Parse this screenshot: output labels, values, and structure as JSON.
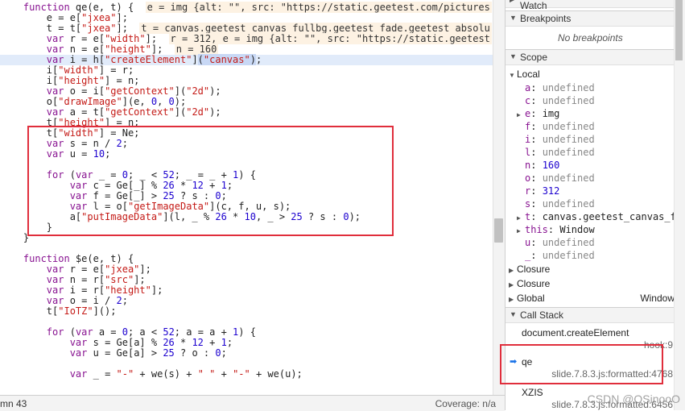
{
  "code_lines": [
    {
      "parts": [
        {
          "t": "    "
        },
        {
          "c": "kw",
          "t": "function"
        },
        {
          "t": " qe(e, t) {  "
        },
        {
          "c": "inline-val",
          "t": "e = img {alt: \"\", src: \"https://static.geetest.com/pictures"
        }
      ]
    },
    {
      "parts": [
        {
          "t": "        e = e["
        },
        {
          "c": "str",
          "t": "\"jxea\""
        },
        {
          "t": "];"
        }
      ]
    },
    {
      "parts": [
        {
          "t": "        t = t["
        },
        {
          "c": "str",
          "t": "\"jxea\""
        },
        {
          "t": "];  "
        },
        {
          "c": "inline-val",
          "t": "t = canvas.geetest_canvas_fullbg.geetest_fade.geetest_absolu"
        }
      ]
    },
    {
      "parts": [
        {
          "t": "        "
        },
        {
          "c": "kw",
          "t": "var"
        },
        {
          "t": " r = e["
        },
        {
          "c": "str",
          "t": "\"width\""
        },
        {
          "t": "];  "
        },
        {
          "c": "inline-val",
          "t": "r = 312, e = img {alt: \"\", src: \"https://static.geetest"
        }
      ]
    },
    {
      "parts": [
        {
          "t": "        "
        },
        {
          "c": "kw",
          "t": "var"
        },
        {
          "t": " n = e["
        },
        {
          "c": "str",
          "t": "\"height\""
        },
        {
          "t": "];  "
        },
        {
          "c": "inline-val",
          "t": "n = 160"
        }
      ]
    },
    {
      "exec": true,
      "parts": [
        {
          "t": "        "
        },
        {
          "c": "kw",
          "t": "var"
        },
        {
          "t": " i = h["
        },
        {
          "c": "str",
          "t": "\"createElement\""
        },
        {
          "t": "]"
        },
        {
          "c": "sel",
          "t": "("
        },
        {
          "c": "str sel",
          "t": "\"canvas\""
        },
        {
          "c": "sel",
          "t": ")"
        },
        {
          "t": ";"
        }
      ]
    },
    {
      "parts": [
        {
          "t": "        i["
        },
        {
          "c": "str",
          "t": "\"width\""
        },
        {
          "t": "] = r;"
        }
      ]
    },
    {
      "parts": [
        {
          "t": "        i["
        },
        {
          "c": "str",
          "t": "\"height\""
        },
        {
          "t": "] = n;"
        }
      ]
    },
    {
      "parts": [
        {
          "t": "        "
        },
        {
          "c": "kw",
          "t": "var"
        },
        {
          "t": " o = i["
        },
        {
          "c": "str",
          "t": "\"getContext\""
        },
        {
          "t": "]("
        },
        {
          "c": "str",
          "t": "\"2d\""
        },
        {
          "t": ");"
        }
      ]
    },
    {
      "parts": [
        {
          "t": "        o["
        },
        {
          "c": "str",
          "t": "\"drawImage\""
        },
        {
          "t": "](e, "
        },
        {
          "c": "num",
          "t": "0"
        },
        {
          "t": ", "
        },
        {
          "c": "num",
          "t": "0"
        },
        {
          "t": ");"
        }
      ]
    },
    {
      "parts": [
        {
          "t": "        "
        },
        {
          "c": "kw",
          "t": "var"
        },
        {
          "t": " a = t["
        },
        {
          "c": "str",
          "t": "\"getContext\""
        },
        {
          "t": "]("
        },
        {
          "c": "str",
          "t": "\"2d\""
        },
        {
          "t": ");"
        }
      ]
    },
    {
      "parts": [
        {
          "t": "        t["
        },
        {
          "c": "str",
          "t": "\"height\""
        },
        {
          "t": "] = n;"
        }
      ]
    },
    {
      "parts": [
        {
          "t": "        t["
        },
        {
          "c": "str",
          "t": "\"width\""
        },
        {
          "t": "] = Ne;"
        }
      ]
    },
    {
      "parts": [
        {
          "t": "        "
        },
        {
          "c": "kw",
          "t": "var"
        },
        {
          "t": " s = n / "
        },
        {
          "c": "num",
          "t": "2"
        },
        {
          "t": ";"
        }
      ]
    },
    {
      "parts": [
        {
          "t": "        "
        },
        {
          "c": "kw",
          "t": "var"
        },
        {
          "t": " u = "
        },
        {
          "c": "num",
          "t": "10"
        },
        {
          "t": ";"
        }
      ]
    },
    {
      "parts": [
        {
          "t": ""
        }
      ]
    },
    {
      "parts": [
        {
          "t": "        "
        },
        {
          "c": "kw",
          "t": "for"
        },
        {
          "t": " ("
        },
        {
          "c": "kw",
          "t": "var"
        },
        {
          "t": " _ = "
        },
        {
          "c": "num",
          "t": "0"
        },
        {
          "t": "; _ < "
        },
        {
          "c": "num",
          "t": "52"
        },
        {
          "t": "; _ = _ + "
        },
        {
          "c": "num",
          "t": "1"
        },
        {
          "t": ") {"
        }
      ]
    },
    {
      "parts": [
        {
          "t": "            "
        },
        {
          "c": "kw",
          "t": "var"
        },
        {
          "t": " c = Ge[_] % "
        },
        {
          "c": "num",
          "t": "26"
        },
        {
          "t": " * "
        },
        {
          "c": "num",
          "t": "12"
        },
        {
          "t": " + "
        },
        {
          "c": "num",
          "t": "1"
        },
        {
          "t": ";"
        }
      ]
    },
    {
      "parts": [
        {
          "t": "            "
        },
        {
          "c": "kw",
          "t": "var"
        },
        {
          "t": " f = Ge[_] > "
        },
        {
          "c": "num",
          "t": "25"
        },
        {
          "t": " ? s : "
        },
        {
          "c": "num",
          "t": "0"
        },
        {
          "t": ";"
        }
      ]
    },
    {
      "parts": [
        {
          "t": "            "
        },
        {
          "c": "kw",
          "t": "var"
        },
        {
          "t": " l = o["
        },
        {
          "c": "str",
          "t": "\"getImageData\""
        },
        {
          "t": "](c, f, u, s);"
        }
      ]
    },
    {
      "parts": [
        {
          "t": "            a["
        },
        {
          "c": "str",
          "t": "\"putImageData\""
        },
        {
          "t": "](l, _ % "
        },
        {
          "c": "num",
          "t": "26"
        },
        {
          "t": " * "
        },
        {
          "c": "num",
          "t": "10"
        },
        {
          "t": ", _ > "
        },
        {
          "c": "num",
          "t": "25"
        },
        {
          "t": " ? s : "
        },
        {
          "c": "num",
          "t": "0"
        },
        {
          "t": ");"
        }
      ]
    },
    {
      "parts": [
        {
          "t": "        }"
        }
      ]
    },
    {
      "parts": [
        {
          "t": "    }"
        }
      ]
    },
    {
      "parts": [
        {
          "t": ""
        }
      ]
    },
    {
      "parts": [
        {
          "t": "    "
        },
        {
          "c": "kw",
          "t": "function"
        },
        {
          "t": " $e(e, t) {"
        }
      ]
    },
    {
      "parts": [
        {
          "t": "        "
        },
        {
          "c": "kw",
          "t": "var"
        },
        {
          "t": " r = e["
        },
        {
          "c": "str",
          "t": "\"jxea\""
        },
        {
          "t": "];"
        }
      ]
    },
    {
      "parts": [
        {
          "t": "        "
        },
        {
          "c": "kw",
          "t": "var"
        },
        {
          "t": " n = r["
        },
        {
          "c": "str",
          "t": "\"src\""
        },
        {
          "t": "];"
        }
      ]
    },
    {
      "parts": [
        {
          "t": "        "
        },
        {
          "c": "kw",
          "t": "var"
        },
        {
          "t": " i = r["
        },
        {
          "c": "str",
          "t": "\"height\""
        },
        {
          "t": "];"
        }
      ]
    },
    {
      "parts": [
        {
          "t": "        "
        },
        {
          "c": "kw",
          "t": "var"
        },
        {
          "t": " o = i / "
        },
        {
          "c": "num",
          "t": "2"
        },
        {
          "t": ";"
        }
      ]
    },
    {
      "parts": [
        {
          "t": "        t["
        },
        {
          "c": "str",
          "t": "\"IoTZ\""
        },
        {
          "t": "]();"
        }
      ]
    },
    {
      "parts": [
        {
          "t": ""
        }
      ]
    },
    {
      "parts": [
        {
          "t": "        "
        },
        {
          "c": "kw",
          "t": "for"
        },
        {
          "t": " ("
        },
        {
          "c": "kw",
          "t": "var"
        },
        {
          "t": " a = "
        },
        {
          "c": "num",
          "t": "0"
        },
        {
          "t": "; a < "
        },
        {
          "c": "num",
          "t": "52"
        },
        {
          "t": "; a = a + "
        },
        {
          "c": "num",
          "t": "1"
        },
        {
          "t": ") {"
        }
      ]
    },
    {
      "parts": [
        {
          "t": "            "
        },
        {
          "c": "kw",
          "t": "var"
        },
        {
          "t": " s = Ge[a] % "
        },
        {
          "c": "num",
          "t": "26"
        },
        {
          "t": " * "
        },
        {
          "c": "num",
          "t": "12"
        },
        {
          "t": " + "
        },
        {
          "c": "num",
          "t": "1"
        },
        {
          "t": ";"
        }
      ]
    },
    {
      "parts": [
        {
          "t": "            "
        },
        {
          "c": "kw",
          "t": "var"
        },
        {
          "t": " u = Ge[a] > "
        },
        {
          "c": "num",
          "t": "25"
        },
        {
          "t": " ? o : "
        },
        {
          "c": "num",
          "t": "0"
        },
        {
          "t": ";"
        }
      ]
    },
    {
      "parts": [
        {
          "t": ""
        }
      ]
    },
    {
      "parts": [
        {
          "t": "            "
        },
        {
          "c": "kw",
          "t": "var"
        },
        {
          "t": " _ = "
        },
        {
          "c": "str",
          "t": "\"-\""
        },
        {
          "t": " + we(s) + "
        },
        {
          "c": "str",
          "t": "\" \""
        },
        {
          "t": " + "
        },
        {
          "c": "str",
          "t": "\"-\""
        },
        {
          "t": " + we(u);"
        }
      ]
    }
  ],
  "status": {
    "left": "mn 43",
    "coverage": "Coverage: n/a"
  },
  "sidebar": {
    "watch_label": "Watch",
    "breakpoints_label": "Breakpoints",
    "no_breakpoints": "No breakpoints",
    "scope_label": "Scope",
    "local_label": "Local",
    "vars": [
      {
        "name": "a",
        "value": "undefined",
        "kind": "undef"
      },
      {
        "name": "c",
        "value": "undefined",
        "kind": "undef"
      },
      {
        "name": "e",
        "value": "img",
        "kind": "obj",
        "expand": true
      },
      {
        "name": "f",
        "value": "undefined",
        "kind": "undef"
      },
      {
        "name": "i",
        "value": "undefined",
        "kind": "undef"
      },
      {
        "name": "l",
        "value": "undefined",
        "kind": "undef"
      },
      {
        "name": "n",
        "value": "160",
        "kind": "num"
      },
      {
        "name": "o",
        "value": "undefined",
        "kind": "undef"
      },
      {
        "name": "r",
        "value": "312",
        "kind": "num"
      },
      {
        "name": "s",
        "value": "undefined",
        "kind": "undef"
      },
      {
        "name": "t",
        "value": "canvas.geetest_canvas_f",
        "kind": "obj",
        "expand": true
      },
      {
        "name": "this",
        "value": "Window",
        "kind": "obj",
        "expand": true
      },
      {
        "name": "u",
        "value": "undefined",
        "kind": "undef"
      },
      {
        "name": "_",
        "value": "undefined",
        "kind": "undef"
      }
    ],
    "closure1": "Closure",
    "closure2": "Closure",
    "global_label": "Global",
    "global_value": "Window",
    "callstack_label": "Call Stack",
    "frames": [
      {
        "name": "document.createElement",
        "loc": "hook:9"
      },
      {
        "name": "qe",
        "loc": "slide.7.8.3.js:formatted:4768",
        "current": true
      },
      {
        "name": "XZIS",
        "loc": "slide.7.8.3.js:formatted:6456"
      }
    ]
  },
  "watermark": "CSDN @OSinooO"
}
